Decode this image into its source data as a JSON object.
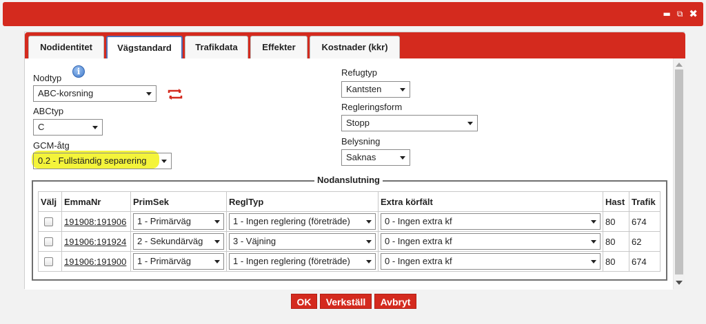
{
  "window": {
    "minimize_glyph": "▬",
    "popout_glyph": "⧉",
    "close_glyph": "✖"
  },
  "tabs": [
    {
      "label": "Nodidentitet"
    },
    {
      "label": "Vägstandard"
    },
    {
      "label": "Trafikdata"
    },
    {
      "label": "Effekter"
    },
    {
      "label": "Kostnader (kkr)"
    }
  ],
  "form": {
    "nodtyp_label": "Nodtyp",
    "nodtyp_value": "ABC-korsning",
    "abctyp_label": "ABCtyp",
    "abctyp_value": "C",
    "gcm_label": "GCM-åtg",
    "gcm_value": "0.2 - Fullständig separering",
    "refugtyp_label": "Refugtyp",
    "refugtyp_value": "Kantsten",
    "regleringsform_label": "Regleringsform",
    "regleringsform_value": "Stopp",
    "belysning_label": "Belysning",
    "belysning_value": "Saknas",
    "info_glyph": "i"
  },
  "nodanslutning": {
    "title": "Nodanslutning",
    "headers": [
      "Välj",
      "EmmaNr",
      "PrimSek",
      "ReglTyp",
      "Extra körfält",
      "Hast",
      "Trafik"
    ],
    "rows": [
      {
        "emmanr": "191908:191906",
        "primsek": "1 - Primärväg",
        "regltyp": "1 - Ingen reglering (företräde)",
        "extra": "0 - Ingen extra kf",
        "hast": "80",
        "trafik": "674"
      },
      {
        "emmanr": "191906:191924",
        "primsek": "2 - Sekundärväg",
        "regltyp": "3 - Väjning",
        "extra": "0 - Ingen extra kf",
        "hast": "80",
        "trafik": "62"
      },
      {
        "emmanr": "191906:191900",
        "primsek": "1 - Primärväg",
        "regltyp": "1 - Ingen reglering (företräde)",
        "extra": "0 - Ingen extra kf",
        "hast": "80",
        "trafik": "674"
      }
    ]
  },
  "buttons": {
    "ok": "OK",
    "apply": "Verkställ",
    "cancel": "Avbryt"
  },
  "colors": {
    "accent": "#d42a1e",
    "active_tab_border": "#4d6fb8",
    "highlight": "#f4f43a"
  }
}
